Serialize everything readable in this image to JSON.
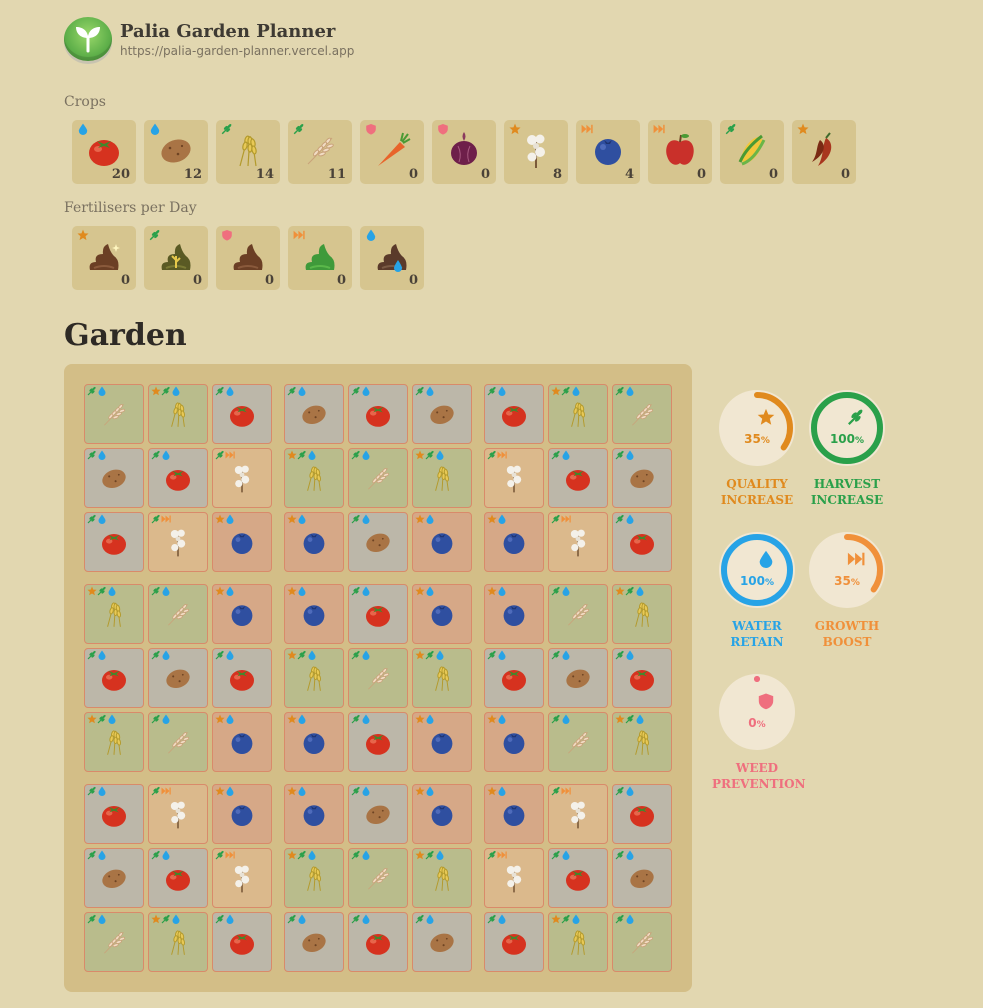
{
  "app": {
    "title": "Palia Garden Planner",
    "url": "https://palia-garden-planner.vercel.app"
  },
  "crops_label": "Crops",
  "crops": [
    {
      "name": "tomato",
      "tag": "water",
      "count": "20"
    },
    {
      "name": "potato",
      "tag": "water",
      "count": "12"
    },
    {
      "name": "wheat",
      "tag": "harvest",
      "count": "14"
    },
    {
      "name": "rice",
      "tag": "harvest",
      "count": "11"
    },
    {
      "name": "carrot",
      "tag": "weed",
      "count": "0"
    },
    {
      "name": "onion",
      "tag": "weed",
      "count": "0"
    },
    {
      "name": "cotton",
      "tag": "quality",
      "count": "8"
    },
    {
      "name": "blueberry",
      "tag": "growth",
      "count": "4"
    },
    {
      "name": "apple",
      "tag": "growth",
      "count": "0"
    },
    {
      "name": "corn",
      "tag": "harvest",
      "count": "0"
    },
    {
      "name": "spicy-pepper",
      "tag": "quality",
      "count": "0"
    }
  ],
  "fertilisers_label": "Fertilisers per Day",
  "fertilisers": [
    {
      "name": "quality-up",
      "tag": "quality",
      "count": "0"
    },
    {
      "name": "harvest-boost",
      "tag": "harvest",
      "count": "0"
    },
    {
      "name": "weed-block",
      "tag": "weed",
      "count": "0"
    },
    {
      "name": "speedy-gro",
      "tag": "growth",
      "count": "0"
    },
    {
      "name": "hydrate-pro",
      "tag": "water",
      "count": "0"
    }
  ],
  "garden_title": "Garden",
  "stats": [
    {
      "key": "quality",
      "pct": "35",
      "label1": "QUALITY",
      "label2": "INCREASE",
      "color": "#e08a1e",
      "fraction": 0.35
    },
    {
      "key": "harvest",
      "pct": "100",
      "label1": "HARVEST",
      "label2": "INCREASE",
      "color": "#2aa04a",
      "fraction": 1.0
    },
    {
      "key": "water",
      "pct": "100",
      "label1": "WATER",
      "label2": "RETAIN",
      "color": "#27a3e6",
      "fraction": 1.0
    },
    {
      "key": "growth",
      "pct": "35",
      "label1": "GROWTH",
      "label2": "BOOST",
      "color": "#f0903a",
      "fraction": 0.35
    },
    {
      "key": "weed",
      "pct": "0",
      "label1": "WEED",
      "label2": "PREVENTION",
      "color": "#ef6f7e",
      "fraction": 0.0
    }
  ],
  "pct_suffix": "%",
  "colors": {
    "quality": "#e08a1e",
    "harvest": "#2aa04a",
    "water": "#27a3e6",
    "growth": "#f0903a",
    "weed": "#ef6f7e"
  },
  "garden": [
    [
      "rice",
      "wheat",
      "tomato",
      "potato",
      "tomato",
      "potato",
      "tomato",
      "wheat",
      "rice"
    ],
    [
      "potato",
      "tomato",
      "cotton",
      "wheat",
      "rice",
      "wheat",
      "cotton",
      "tomato",
      "potato"
    ],
    [
      "tomato",
      "cotton",
      "blueberry",
      "blueberry",
      "potato",
      "blueberry",
      "blueberry",
      "cotton",
      "tomato"
    ],
    [
      "wheat",
      "rice",
      "blueberry",
      "blueberry",
      "tomato",
      "blueberry",
      "blueberry",
      "rice",
      "wheat"
    ],
    [
      "tomato",
      "potato",
      "tomato",
      "wheat",
      "rice",
      "wheat",
      "tomato",
      "potato",
      "tomato"
    ],
    [
      "wheat",
      "rice",
      "blueberry",
      "blueberry",
      "tomato",
      "blueberry",
      "blueberry",
      "rice",
      "wheat"
    ],
    [
      "tomato",
      "cotton",
      "blueberry",
      "blueberry",
      "potato",
      "blueberry",
      "blueberry",
      "cotton",
      "tomato"
    ],
    [
      "potato",
      "tomato",
      "cotton",
      "wheat",
      "rice",
      "wheat",
      "cotton",
      "tomato",
      "potato"
    ],
    [
      "rice",
      "wheat",
      "tomato",
      "potato",
      "tomato",
      "potato",
      "tomato",
      "wheat",
      "rice"
    ]
  ]
}
